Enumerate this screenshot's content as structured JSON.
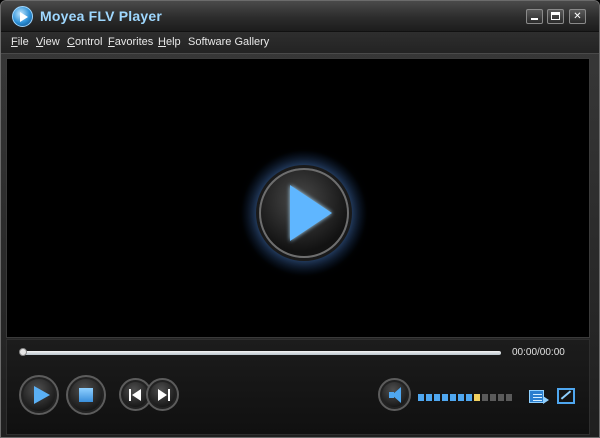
{
  "window": {
    "title": "Moyea FLV Player",
    "buttons": {
      "minimize": "minimize",
      "maximize": "maximize",
      "close": "✕"
    }
  },
  "menu": {
    "items": [
      {
        "label_u": "F",
        "label_rest": "ile"
      },
      {
        "label_u": "V",
        "label_rest": "iew"
      },
      {
        "label_u": "C",
        "label_rest": "ontrol"
      },
      {
        "label_u": "F",
        "label_rest": "avorites"
      },
      {
        "label_u": "H",
        "label_rest": "elp"
      },
      {
        "label_u": "",
        "label_rest": "Software Gallery"
      }
    ]
  },
  "player": {
    "time": "00:00/00:00",
    "progress": 0,
    "volume_segments": 12,
    "volume_level_segment": 8
  },
  "icons": {
    "app_logo": "moyea-logo-icon",
    "big_play": "play-icon",
    "play": "play-icon",
    "stop": "stop-icon",
    "previous": "previous-track-icon",
    "next": "next-track-icon",
    "volume": "speaker-icon",
    "playlist": "playlist-icon",
    "resize": "resize-icon"
  },
  "colors": {
    "accent": "#5ab0f5",
    "title_text": "#9fd8ff",
    "volume_active": "#4fa7f0",
    "volume_level": "#f0d060",
    "volume_inactive": "#5a5a5a"
  }
}
